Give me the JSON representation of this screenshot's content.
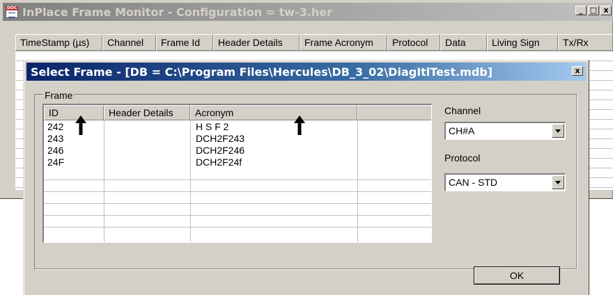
{
  "bg_window": {
    "title": "InPlace Frame Monitor  - Configuration = tw-3.her",
    "icon_text": "DOC",
    "controls": {
      "minimize": "_",
      "maximize": "□",
      "close": "x"
    },
    "columns": [
      "TimeStamp (µs)",
      "Channel",
      "Frame Id",
      "Header Details",
      "Frame Acronym",
      "Protocol",
      "Data",
      "Living Sign",
      "Tx/Rx"
    ]
  },
  "dialog": {
    "title": "Select Frame - [DB = C:\\Program Files\\Hercules\\DB_3_02\\DiagItlTest.mdb]",
    "close": "x",
    "frame_group_label": "Frame",
    "list": {
      "columns": [
        "ID",
        "Header Details",
        "Acronym",
        ""
      ],
      "rows": [
        {
          "id": "242",
          "header_details": "",
          "acronym": "H S F 2"
        },
        {
          "id": "243",
          "header_details": "",
          "acronym": "DCH2F243"
        },
        {
          "id": "246",
          "header_details": "",
          "acronym": "DCH2F246"
        },
        {
          "id": "24F",
          "header_details": "",
          "acronym": "DCH2F24f"
        }
      ]
    },
    "channel": {
      "label": "Channel",
      "value": "CH#A"
    },
    "protocol": {
      "label": "Protocol",
      "value": "CAN - STD"
    },
    "ok_label": "OK"
  },
  "annotations": {
    "arrow_icon": "up-arrow"
  }
}
